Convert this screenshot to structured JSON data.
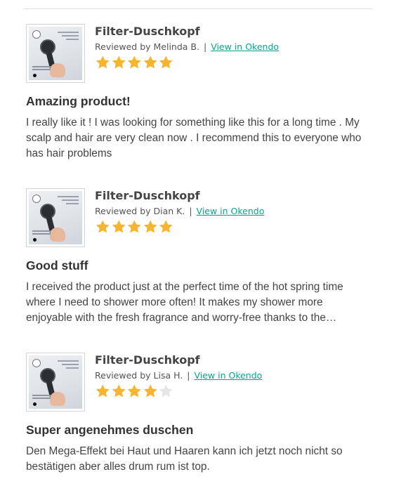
{
  "reviews": [
    {
      "product_name": "Filter-Duschkopf",
      "reviewer": "Reviewed by Melinda B.",
      "separator": "|",
      "link_label": "View in Okendo",
      "rating": 5,
      "title": "Amazing product!",
      "body": "I really like it ! I was looking for something like this for a long time . My scalp and hair are very clean now . I recommend this to everyone who has hair problems"
    },
    {
      "product_name": "Filter-Duschkopf",
      "reviewer": "Reviewed by Dian K.",
      "separator": "|",
      "link_label": "View in Okendo",
      "rating": 5,
      "title": "Good stuff",
      "body": "I received the product just at the perfect time of the hot spring time where I need to shower more often! It makes my shower more enjoyable with the fresh fragrance and worry-free thanks to the…"
    },
    {
      "product_name": "Filter-Duschkopf",
      "reviewer": "Reviewed by Lisa H.",
      "separator": "|",
      "link_label": "View in Okendo",
      "rating": 4,
      "title": "Super angenehmes duschen",
      "body": "Den Mega-Effekt bei Haut und Haaren kann ich jetzt noch nicht so bestätigen aber alles drum rum ist top."
    }
  ],
  "rating_max": 5,
  "colors": {
    "star_filled": "#f7b42c",
    "star_empty": "#e6e6e6",
    "link": "#00a78e"
  },
  "icons": {
    "star": "star-icon",
    "thumbnail": "shower-head-product-image"
  }
}
